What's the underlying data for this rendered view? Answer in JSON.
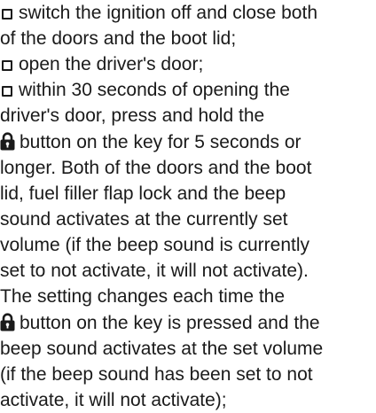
{
  "instructions": {
    "step1": {
      "line1": "switch the ignition off and close both",
      "line2": "of the doors and the boot lid;"
    },
    "step2": {
      "line1": "open the driver's door;"
    },
    "step3": {
      "line1": "within 30 seconds of opening the",
      "line2": "driver's door, press and hold the",
      "line3": "button on the key for 5 seconds or",
      "line4": "longer. Both of the doors and the boot",
      "line5": "lid, fuel filler flap lock and the beep",
      "line6": "sound activates at the currently set",
      "line7": "volume (if the beep sound is currently",
      "line8": "set to not activate, it will not activate).",
      "line9": "The setting changes each time the",
      "line10": "button on the key is pressed and the",
      "line11": "beep sound activates at the set volume",
      "line12": "(if the beep sound has been set to not",
      "line13": "activate, it will not activate);"
    }
  },
  "icons": {
    "bullet": "checkbox-icon",
    "lock_button": "padlock-icon"
  }
}
